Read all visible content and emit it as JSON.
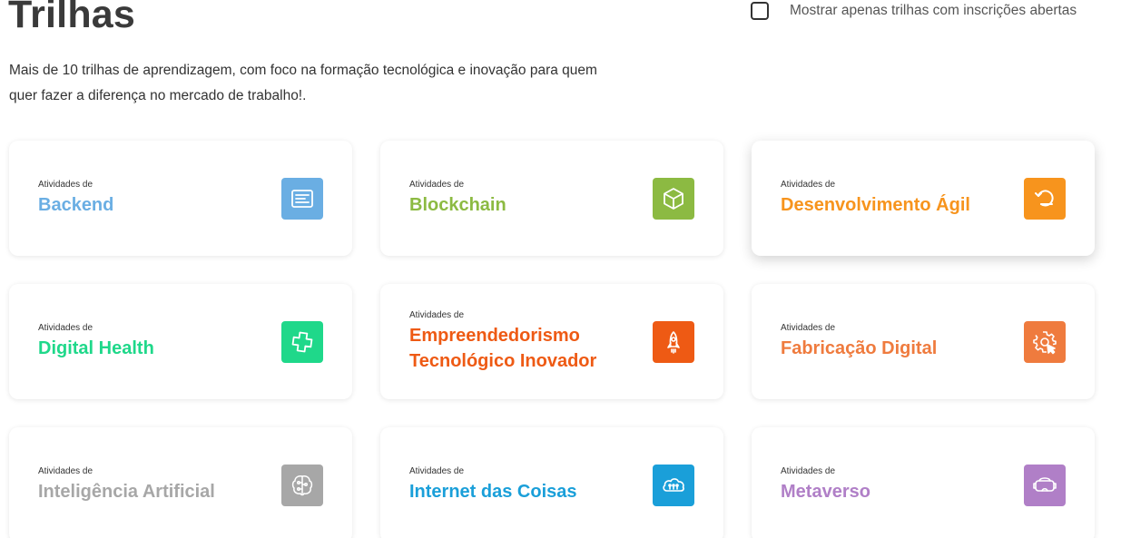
{
  "header": {
    "title": "Trilhas",
    "subtitle": "Mais de 10 trilhas de aprendizagem, com foco na formação tecnológica e inovação para quem quer fazer a diferença no mercado de trabalho!.",
    "filter_label": "Mostrar apenas trilhas com inscrições abertas",
    "filter_checked": false
  },
  "tracks": [
    {
      "prefix": "Atividades de",
      "name": "Backend",
      "color": "#6aaee3",
      "icon": "code-window-icon"
    },
    {
      "prefix": "Atividades de",
      "name": "Blockchain",
      "color": "#8cba42",
      "icon": "cube-icon"
    },
    {
      "prefix": "Atividades de",
      "name": "Desenvolvimento Ágil",
      "color": "#f7941d",
      "icon": "refresh-arrow-icon"
    },
    {
      "prefix": "Atividades de",
      "name": "Digital Health",
      "color": "#1fd88a",
      "icon": "health-cross-icon"
    },
    {
      "prefix": "Atividades de",
      "name": "Empreendedorismo Tecnológico Inovador",
      "color": "#ee5a14",
      "icon": "rocket-icon"
    },
    {
      "prefix": "Atividades de",
      "name": "Fabricação Digital",
      "color": "#ef7b3e",
      "icon": "gear-cursor-icon"
    },
    {
      "prefix": "Atividades de",
      "name": "Inteligência Artificial",
      "color": "#a7a7a7",
      "icon": "brain-circuit-icon"
    },
    {
      "prefix": "Atividades de",
      "name": "Internet das Coisas",
      "color": "#1a9fd9",
      "icon": "cloud-network-icon"
    },
    {
      "prefix": "Atividades de",
      "name": "Metaverso",
      "color": "#b07fc7",
      "icon": "vr-headset-icon"
    }
  ]
}
